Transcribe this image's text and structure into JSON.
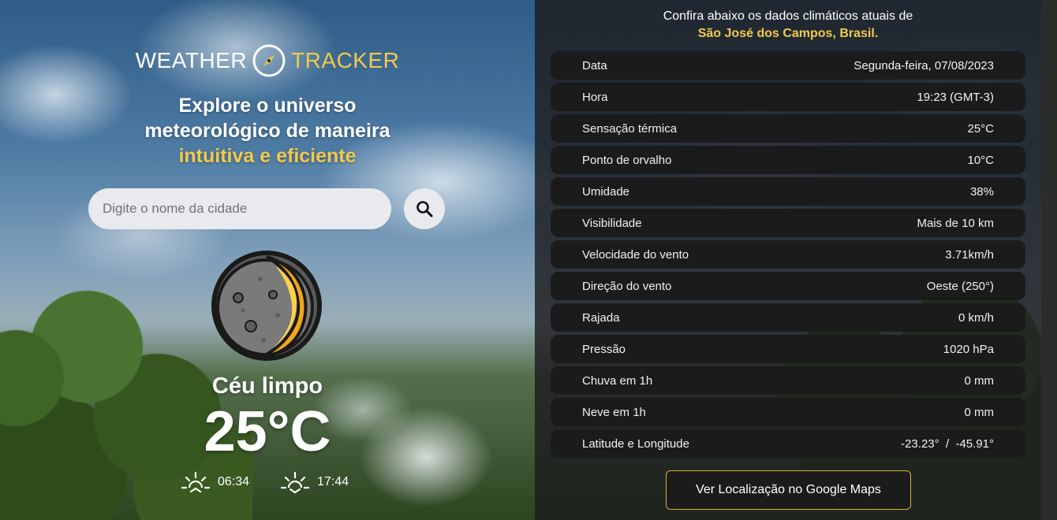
{
  "brand": {
    "word1": "WEATHER",
    "word2": "TRACKER",
    "accent_color": "#f2c94c"
  },
  "hero": {
    "line1": "Explore o universo",
    "line2": "meteorológico de maneira",
    "line3_accent": "intuitiva e eficiente"
  },
  "search": {
    "placeholder": "Digite o nome da cidade",
    "value": "",
    "button_icon": "search-icon"
  },
  "current": {
    "icon": "crescent-moon-icon",
    "condition": "Céu limpo",
    "temperature": "25°C",
    "sunrise": "06:34",
    "sunset": "17:44"
  },
  "details": {
    "intro": "Confira abaixo os dados climáticos atuais de",
    "city": "São José dos Campos, Brasil.",
    "rows": [
      {
        "label": "Data",
        "value": "Segunda-feira, 07/08/2023"
      },
      {
        "label": "Hora",
        "value": "19:23 (GMT-3)"
      },
      {
        "label": "Sensação térmica",
        "value": "25°C"
      },
      {
        "label": "Ponto de orvalho",
        "value": "10°C"
      },
      {
        "label": "Umidade",
        "value": "38%"
      },
      {
        "label": "Visibilidade",
        "value": "Mais de 10 km"
      },
      {
        "label": "Velocidade do vento",
        "value": "3.71km/h"
      },
      {
        "label": "Direção do vento",
        "value": "Oeste (250°)"
      },
      {
        "label": "Rajada",
        "value": "0 km/h"
      },
      {
        "label": "Pressão",
        "value": "1020 hPa"
      },
      {
        "label": "Chuva em 1h",
        "value": "0 mm"
      },
      {
        "label": "Neve em 1h",
        "value": "0 mm"
      },
      {
        "label": "Latitude e Longitude",
        "value": "-23.23°  /  -45.91°"
      }
    ],
    "maps_button": "Ver Localização no Google Maps"
  }
}
